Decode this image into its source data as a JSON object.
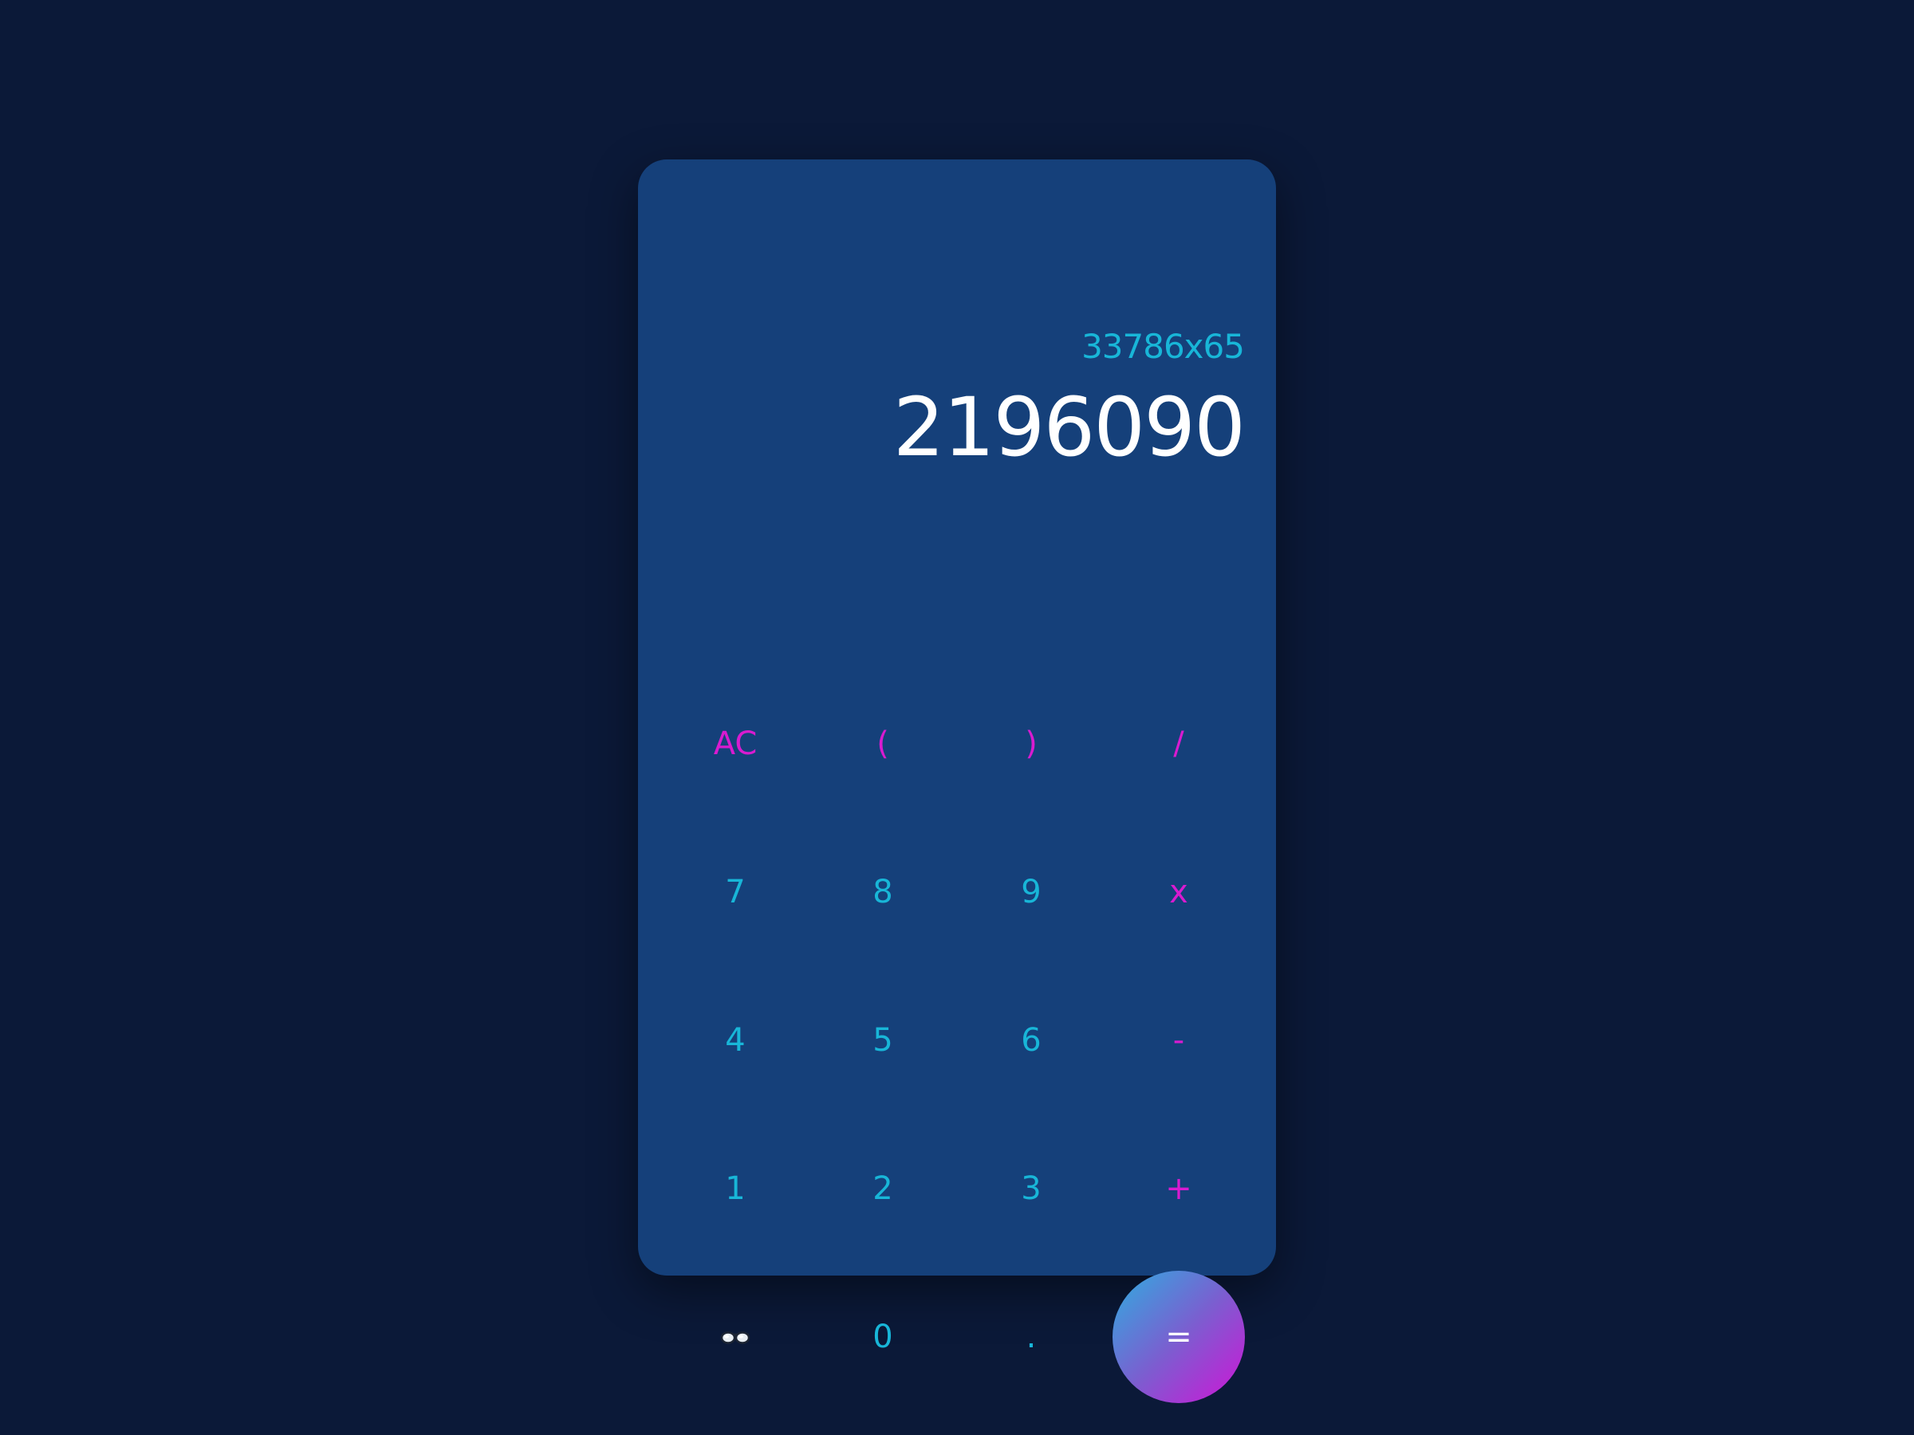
{
  "display": {
    "expression": "33786x65",
    "result": "2196090"
  },
  "keys": {
    "clear": "AC",
    "open_paren": "(",
    "close_paren": ")",
    "divide": "/",
    "seven": "7",
    "eight": "8",
    "nine": "9",
    "multiply": "x",
    "four": "4",
    "five": "5",
    "six": "6",
    "subtract": "-",
    "one": "1",
    "two": "2",
    "three": "3",
    "add": "+",
    "theme_icon": "glasses-icon",
    "zero": "0",
    "decimal": ".",
    "equals": "="
  },
  "colors": {
    "background": "#0b1938",
    "panel": "#15407a",
    "number_key": "#18b6d8",
    "operator_key": "#d81bd0",
    "result_text": "#ffffff",
    "equals_gradient_start": "#2eaee0",
    "equals_gradient_end": "#d014d6"
  }
}
